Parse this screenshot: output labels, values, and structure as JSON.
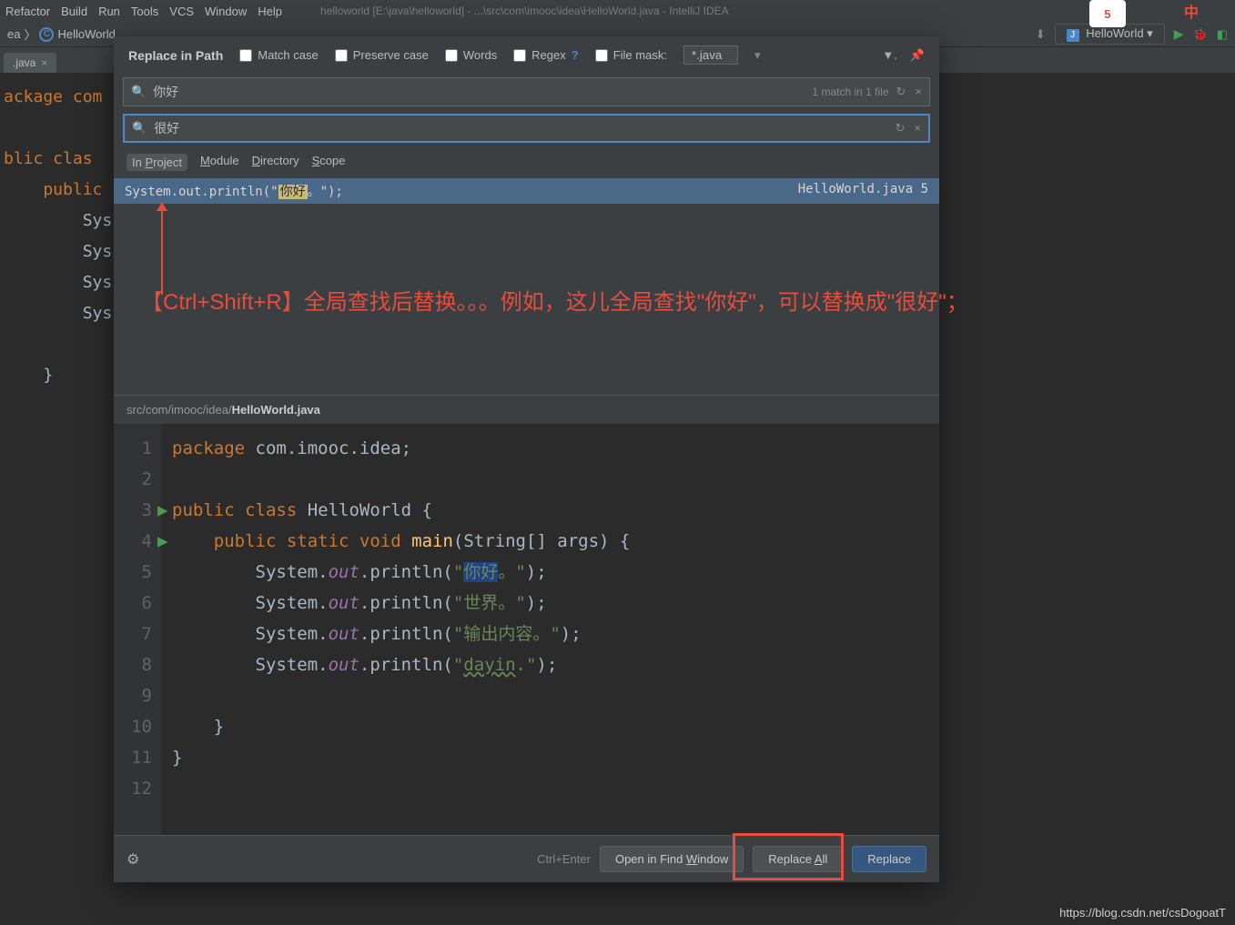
{
  "menubar": {
    "items": [
      "Refactor",
      "Build",
      "Run",
      "Tools",
      "VCS",
      "Window",
      "Help"
    ],
    "titlepath": "helloworld [E:\\java\\helloworld] - ...\\src\\com\\imooc\\idea\\HelloWorld.java - IntelliJ IDEA"
  },
  "breadcrumb": {
    "left_suffix": "ea",
    "file": "HelloWorld",
    "run_config": "HelloWorld"
  },
  "tab": {
    "name": ".java"
  },
  "bg_editor": {
    "lines": [
      {
        "t": "ackage com",
        "cls": "kw"
      },
      {
        "t": "",
        "cls": ""
      },
      {
        "t": "blic clas",
        "cls": "kw"
      },
      {
        "t": "    public ",
        "cls": "kw"
      },
      {
        "t": "        Sys",
        "cls": ""
      },
      {
        "t": "        Sys",
        "cls": ""
      },
      {
        "t": "        Sys",
        "cls": ""
      },
      {
        "t": "        Sys",
        "cls": ""
      },
      {
        "t": "",
        "cls": ""
      },
      {
        "t": "    }",
        "cls": ""
      }
    ]
  },
  "dialog": {
    "title": "Replace in Path",
    "checks": {
      "match_case": "Match case",
      "preserve_case": "Preserve case",
      "words": "Words",
      "regex": "Regex",
      "file_mask": "File mask:"
    },
    "file_mask_value": "*.java",
    "search_value": "你好",
    "search_status": "1 match in 1 file",
    "replace_value": "很好",
    "scope_tabs": [
      "In Project",
      "Module",
      "Directory",
      "Scope"
    ],
    "result": {
      "prefix": "System.out.println(\"",
      "highlight": "你好",
      "suffix": "。\");",
      "location": "HelloWorld.java 5"
    },
    "annotation": "【Ctrl+Shift+R】全局查找后替换。。。例如，这儿全局查找\"你好\"，可以替换成\"很好\"；",
    "filepath": {
      "dir": "src/com/imooc/idea/",
      "file": "HelloWorld.java"
    },
    "footer": {
      "hint": "Ctrl+Enter",
      "open_find": "Open in Find Window",
      "replace_all": "Replace All",
      "replace": "Replace"
    }
  },
  "preview": {
    "lines": [
      {
        "n": 1,
        "html": "<span class='kw'>package</span> com.imooc.idea;"
      },
      {
        "n": 2,
        "html": ""
      },
      {
        "n": 3,
        "html": "<span class='kw'>public class</span> HelloWorld {",
        "play": true
      },
      {
        "n": 4,
        "html": "    <span class='kw'>public static void</span> <span class='fn'>main</span>(String[] args) {",
        "play": true
      },
      {
        "n": 5,
        "html": "        System.<span class='field'>out</span>.println(<span class='str'>\"<span class='hl'>你好</span>。\"</span>);"
      },
      {
        "n": 6,
        "html": "        System.<span class='field'>out</span>.println(<span class='str'>\"世界。\"</span>);"
      },
      {
        "n": 7,
        "html": "        System.<span class='field'>out</span>.println(<span class='str'>\"输出内容。\"</span>);"
      },
      {
        "n": 8,
        "html": "        System.<span class='field'>out</span>.println(<span class='str'>\"<span class='hl2'>dayin</span>.\"</span>);"
      },
      {
        "n": 9,
        "html": ""
      },
      {
        "n": 10,
        "html": "    }"
      },
      {
        "n": 11,
        "html": "}"
      },
      {
        "n": 12,
        "html": ""
      }
    ]
  },
  "watermark": "https://blog.csdn.net/csDogoatT",
  "corner": {
    "badge": "5",
    "lang": "中"
  }
}
